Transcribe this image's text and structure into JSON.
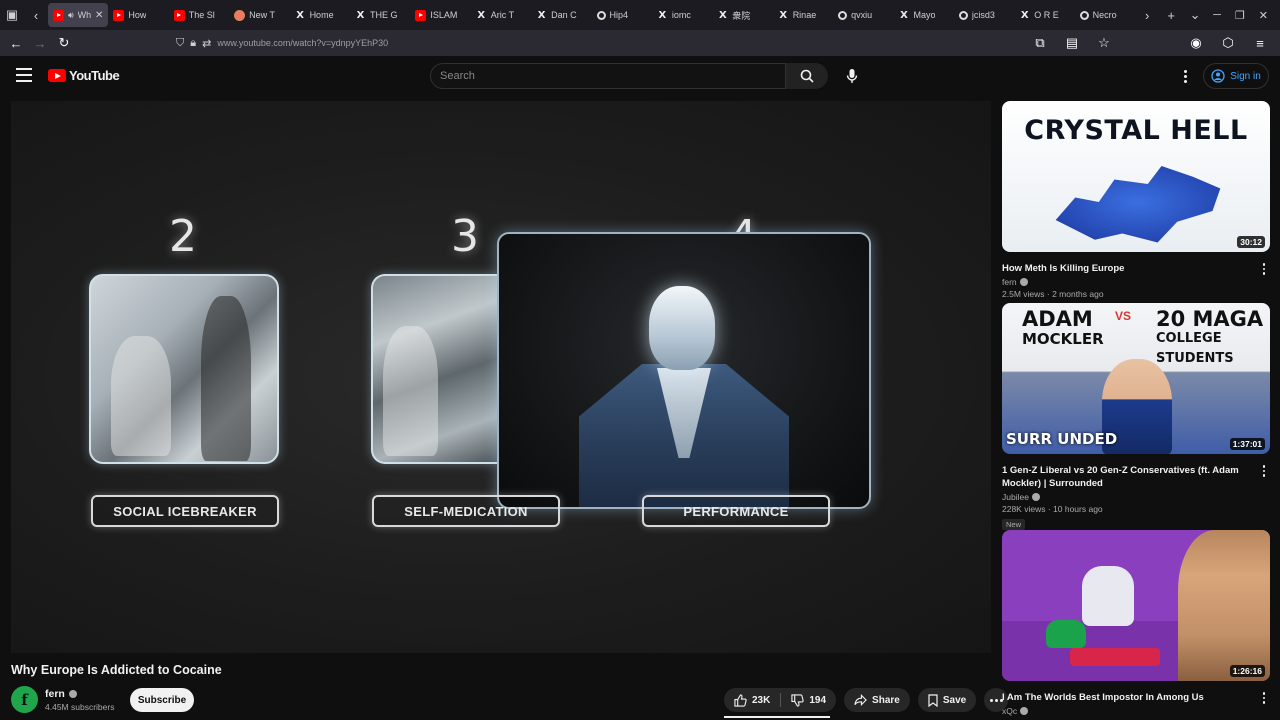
{
  "browser": {
    "tabs": [
      {
        "favicon": "youtube-icon",
        "title": "Wh",
        "active": true,
        "audio": true
      },
      {
        "favicon": "youtube-icon",
        "title": "How"
      },
      {
        "favicon": "youtube-icon",
        "title": "The Sl"
      },
      {
        "favicon": "flower-icon",
        "title": "New T"
      },
      {
        "favicon": "x-icon",
        "title": "Home"
      },
      {
        "favicon": "x-icon",
        "title": "THE G"
      },
      {
        "favicon": "youtube-icon",
        "title": "ISLAM"
      },
      {
        "favicon": "x-icon",
        "title": "Aric T"
      },
      {
        "favicon": "x-icon",
        "title": "Dan C"
      },
      {
        "favicon": "circle-icon",
        "title": "Hip4"
      },
      {
        "favicon": "x-icon",
        "title": "iomc"
      },
      {
        "favicon": "x-icon",
        "title": "衆院"
      },
      {
        "favicon": "x-icon",
        "title": "Rinae"
      },
      {
        "favicon": "circle-icon",
        "title": "qvxiu"
      },
      {
        "favicon": "x-icon",
        "title": "Mayo"
      },
      {
        "favicon": "circle-icon",
        "title": "jcisd3"
      },
      {
        "favicon": "x-icon",
        "title": "O R E"
      },
      {
        "favicon": "circle-icon",
        "title": "Necro"
      }
    ],
    "url": "www.youtube.com/watch?v=ydnpyYEhP30"
  },
  "yt": {
    "logo_text": "YouTube",
    "search_placeholder": "Search",
    "signin_label": "Sign in"
  },
  "player": {
    "numbers": [
      "2",
      "3",
      "4"
    ],
    "labels": [
      "SOCIAL ICEBREAKER",
      "SELF-MEDICATION",
      "PERFORMANCE"
    ]
  },
  "video": {
    "title": "Why Europe Is Addicted to Cocaine",
    "channel": "fern",
    "subscribers": "4.45M subscribers",
    "subscribe_label": "Subscribe",
    "likes": "23K",
    "dislikes": "194",
    "share_label": "Share",
    "save_label": "Save"
  },
  "recommendations": [
    {
      "thumb_text": "CRYSTAL HELL",
      "duration": "30:12",
      "title": "How Meth Is Killing Europe",
      "channel": "fern",
      "meta": "2.5M views · 2 months ago"
    },
    {
      "thumb_text_a": "ADAM",
      "thumb_text_a2": "MOCKLER",
      "thumb_vs": "VS",
      "thumb_text_b": "20 MAGA",
      "thumb_text_b2": "COLLEGE STUDENTS",
      "thumb_corner": "SURR UNDED",
      "duration": "1:37:01",
      "title": "1 Gen-Z Liberal vs 20 Gen-Z Conservatives (ft. Adam Mockler) | Surrounded",
      "channel": "Jubilee",
      "meta": "228K views · 10 hours ago",
      "badge": "New"
    },
    {
      "duration": "1:26:16",
      "title": "I Am The Worlds Best Impostor In Among Us",
      "channel": "xQc"
    }
  ],
  "colors": {
    "accent_red": "#ff0000",
    "link_blue": "#3ea6ff",
    "bg": "#0f0f0f"
  }
}
